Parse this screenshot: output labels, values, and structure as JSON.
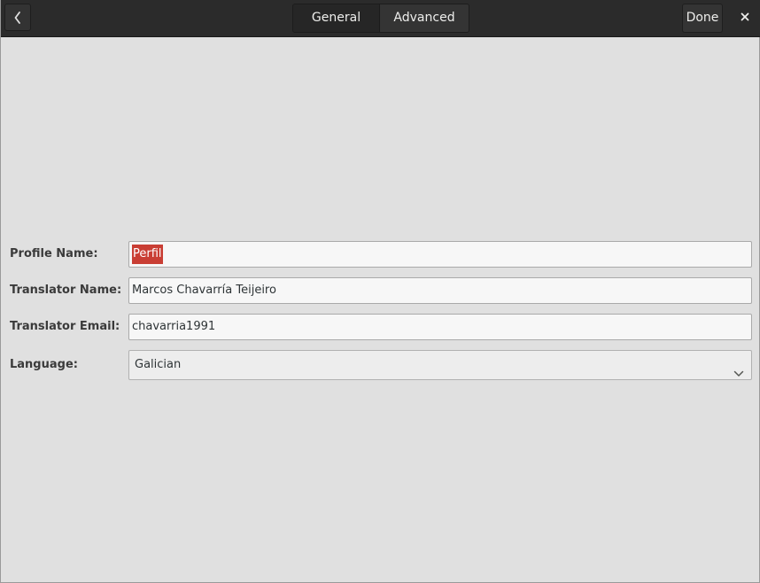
{
  "header": {
    "tabs": [
      {
        "label": "General"
      },
      {
        "label": "Advanced"
      }
    ],
    "done_label": "Done",
    "back_icon": "chevron-left-icon",
    "close_icon": "close-icon"
  },
  "form": {
    "profile_name": {
      "label": "Profile Name:",
      "value": "Perfil"
    },
    "translator_name": {
      "label": "Translator Name:",
      "value": "Marcos Chavarría Teijeiro"
    },
    "translator_email": {
      "label": "Translator Email:",
      "value": "chavarria1991"
    },
    "language": {
      "label": "Language:",
      "value": "Galician"
    }
  },
  "colors": {
    "header_bg": "#2b2b2b",
    "body_bg": "#e0e0e0",
    "selection": "#c93e34"
  }
}
